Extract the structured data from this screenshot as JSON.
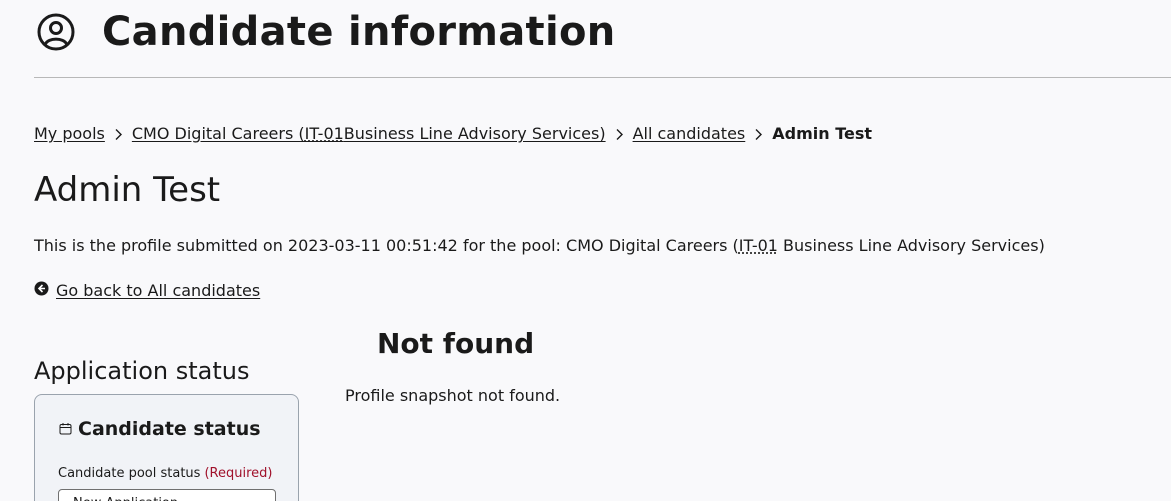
{
  "header": {
    "title": "Candidate information",
    "icon": "user-circle-icon"
  },
  "breadcrumb": {
    "items": [
      {
        "label": "My pools"
      },
      {
        "label_prefix": "CMO Digital Careers (",
        "abbr": "IT-01",
        "label_suffix": "Business Line Advisory Services)"
      },
      {
        "label": "All candidates"
      },
      {
        "label": "Admin Test"
      }
    ],
    "separator_icon": "chevron-right-icon"
  },
  "page": {
    "heading": "Admin Test",
    "description_prefix": "This is the profile submitted on 2023-03-11 00:51:42 for the pool: CMO Digital Careers (",
    "description_abbr": "IT-01",
    "description_suffix": " Business Line Advisory Services)",
    "back_link": "Go back to All candidates",
    "back_icon": "arrow-left-circle-icon"
  },
  "application_status": {
    "heading": "Application status",
    "card": {
      "title": "Candidate status",
      "icon": "calendar-icon",
      "field_label": "Candidate pool status",
      "required_label": "(Required)",
      "select_value": "New Application"
    }
  },
  "not_found": {
    "title": "Not found",
    "message": "Profile snapshot not found."
  },
  "colors": {
    "background": "#f9f9fb",
    "text": "#1a1a1a",
    "required": "#a0112b",
    "card_background": "#f1f3f7"
  }
}
